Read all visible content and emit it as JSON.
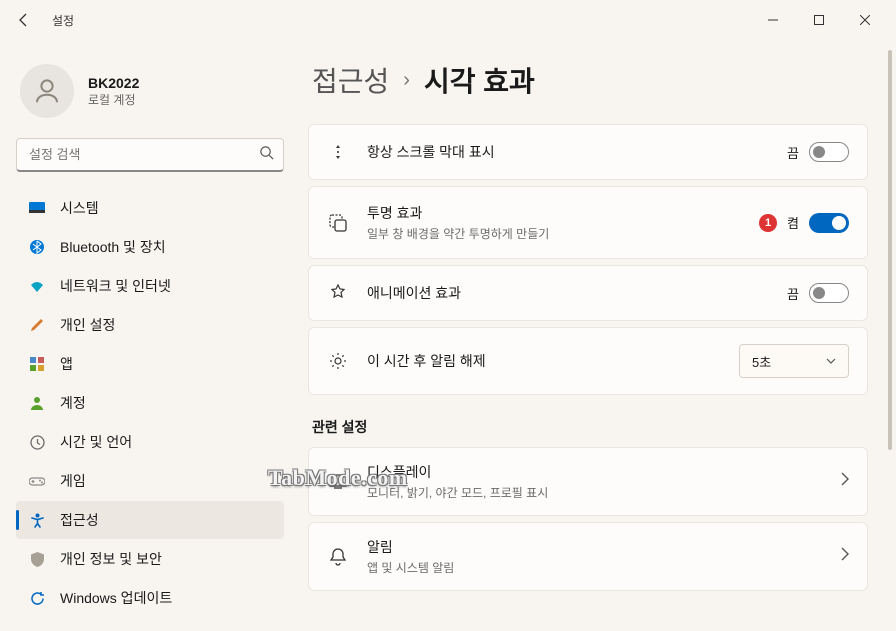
{
  "window": {
    "title": "설정"
  },
  "profile": {
    "name": "BK2022",
    "sub": "로컬 계정"
  },
  "search": {
    "placeholder": "설정 검색"
  },
  "nav": {
    "items": [
      {
        "label": "시스템",
        "icon": "monitor",
        "color": "#0078d4"
      },
      {
        "label": "Bluetooth 및 장치",
        "icon": "bt",
        "color": "#0078d4"
      },
      {
        "label": "네트워크 및 인터넷",
        "icon": "wifi",
        "color": "#0aa3c2"
      },
      {
        "label": "개인 설정",
        "icon": "brush",
        "color": "#d67b2f"
      },
      {
        "label": "앱",
        "icon": "apps",
        "color": "#6e6e6e"
      },
      {
        "label": "계정",
        "icon": "person",
        "color": "#5aa02c"
      },
      {
        "label": "시간 및 언어",
        "icon": "clock",
        "color": "#6b6b6b"
      },
      {
        "label": "게임",
        "icon": "game",
        "color": "#8a8a8a"
      },
      {
        "label": "접근성",
        "icon": "access",
        "color": "#0067c0",
        "active": true
      },
      {
        "label": "개인 정보 및 보안",
        "icon": "shield",
        "color": "#8a8a8a"
      },
      {
        "label": "Windows 업데이트",
        "icon": "update",
        "color": "#0067c0"
      }
    ]
  },
  "breadcrumb": {
    "root": "접근성",
    "current": "시각 효과"
  },
  "settings": {
    "scrollbars": {
      "label": "항상 스크롤 막대 표시",
      "state": "끔",
      "on": false
    },
    "transparency": {
      "label": "투명 효과",
      "sub": "일부 창 배경을 약간 투명하게 만들기",
      "state": "켬",
      "on": true,
      "badge": "1"
    },
    "animation": {
      "label": "애니메이션 효과",
      "state": "끔",
      "on": false
    },
    "dismiss": {
      "label": "이 시간 후 알림 해제",
      "value": "5초"
    }
  },
  "related": {
    "heading": "관련 설정",
    "display": {
      "label": "디스플레이",
      "sub": "모니터, 밝기, 야간 모드, 프로필 표시"
    },
    "notifications": {
      "label": "알림",
      "sub": "앱 및 시스템 알림"
    }
  },
  "watermark": "TabMode.com"
}
